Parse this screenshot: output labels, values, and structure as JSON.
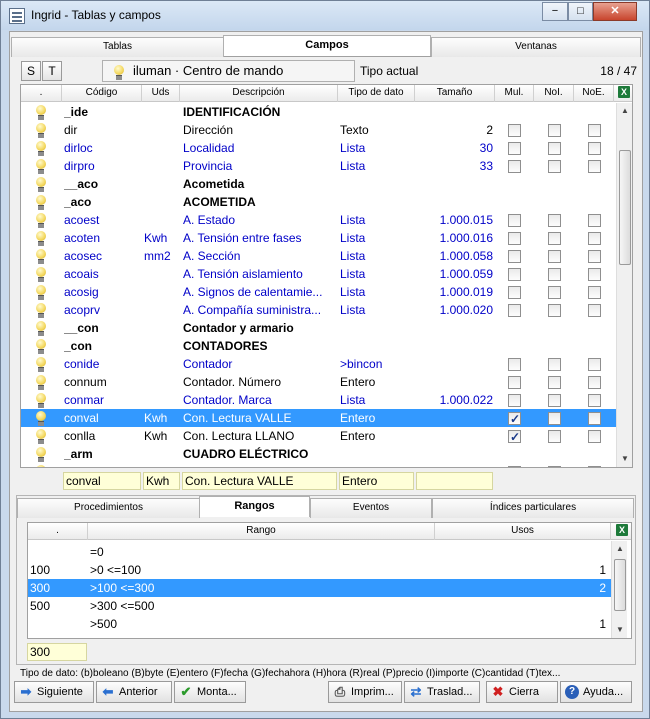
{
  "window": {
    "title": "Ingrid - Tablas y campos",
    "minimize": "−",
    "maximize": "□",
    "close": "✕"
  },
  "tabs_top": [
    "Tablas",
    "Campos",
    "Ventanas"
  ],
  "toolbar": {
    "s": "S",
    "t": "T",
    "context": "iluman · Centro de mando",
    "tipo_actual": "Tipo actual",
    "count": "18 / 47"
  },
  "grid": {
    "headers": {
      "dot": ".",
      "codigo": "Código",
      "uds": "Uds",
      "descripcion": "Descripción",
      "tipo": "Tipo de dato",
      "tamano": "Tamaño",
      "mul": "Mul.",
      "noi": "NoI.",
      "noe": "NoE."
    },
    "rows": [
      {
        "codigo": "_ide",
        "uds": "",
        "desc": "IDENTIFICACIÓN",
        "tipo": "",
        "tam": "",
        "style": "bold",
        "checks": false
      },
      {
        "codigo": "dir",
        "uds": "",
        "desc": "Dirección",
        "tipo": "Texto",
        "tam": "2",
        "style": "normal",
        "checks": true
      },
      {
        "codigo": "dirloc",
        "uds": "",
        "desc": "Localidad",
        "tipo": "Lista",
        "tam": "30",
        "style": "blue",
        "checks": true
      },
      {
        "codigo": "dirpro",
        "uds": "",
        "desc": "Provincia",
        "tipo": "Lista",
        "tam": "33",
        "style": "blue",
        "checks": true
      },
      {
        "codigo": "__aco",
        "uds": "",
        "desc": "Acometida",
        "tipo": "",
        "tam": "",
        "style": "bold",
        "checks": false
      },
      {
        "codigo": "_aco",
        "uds": "",
        "desc": "ACOMETIDA",
        "tipo": "",
        "tam": "",
        "style": "bold",
        "checks": false
      },
      {
        "codigo": "acoest",
        "uds": "",
        "desc": "A. Estado",
        "tipo": "Lista",
        "tam": "1.000.015",
        "style": "blue",
        "checks": true
      },
      {
        "codigo": "acoten",
        "uds": "Kwh",
        "desc": "A. Tensión entre fases",
        "tipo": "Lista",
        "tam": "1.000.016",
        "style": "blue",
        "checks": true
      },
      {
        "codigo": "acosec",
        "uds": "mm2",
        "desc": "A. Sección",
        "tipo": "Lista",
        "tam": "1.000.058",
        "style": "blue",
        "checks": true
      },
      {
        "codigo": "acoais",
        "uds": "",
        "desc": "A. Tensión aislamiento",
        "tipo": "Lista",
        "tam": "1.000.059",
        "style": "blue",
        "checks": true
      },
      {
        "codigo": "acosig",
        "uds": "",
        "desc": "A. Signos de calentamie...",
        "tipo": "Lista",
        "tam": "1.000.019",
        "style": "blue",
        "checks": true
      },
      {
        "codigo": "acoprv",
        "uds": "",
        "desc": "A. Compañía suministra...",
        "tipo": "Lista",
        "tam": "1.000.020",
        "style": "blue",
        "checks": true
      },
      {
        "codigo": "__con",
        "uds": "",
        "desc": "Contador y armario",
        "tipo": "",
        "tam": "",
        "style": "bold",
        "checks": false
      },
      {
        "codigo": "_con",
        "uds": "",
        "desc": "CONTADORES",
        "tipo": "",
        "tam": "",
        "style": "bold",
        "checks": false
      },
      {
        "codigo": "conide",
        "uds": "",
        "desc": "Contador",
        "tipo": ">bincon",
        "tam": "",
        "style": "blue",
        "checks": true
      },
      {
        "codigo": "connum",
        "uds": "",
        "desc": "Contador. Número",
        "tipo": "Entero",
        "tam": "",
        "style": "normal",
        "checks": true
      },
      {
        "codigo": "conmar",
        "uds": "",
        "desc": "Contador. Marca",
        "tipo": "Lista",
        "tam": "1.000.022",
        "style": "blue",
        "checks": true
      },
      {
        "codigo": "conval",
        "uds": "Kwh",
        "desc": "Con. Lectura VALLE",
        "tipo": "Entero",
        "tam": "",
        "style": "normal",
        "checks": true,
        "mul": true,
        "selected": true
      },
      {
        "codigo": "conlla",
        "uds": "Kwh",
        "desc": "Con. Lectura LLANO",
        "tipo": "Entero",
        "tam": "",
        "style": "normal",
        "checks": true,
        "mul": true
      },
      {
        "codigo": "_arm",
        "uds": "",
        "desc": "CUADRO ELÉCTRICO",
        "tipo": "",
        "tam": "",
        "style": "bold",
        "checks": false
      },
      {
        "codigo": "",
        "uds": "",
        "desc": "",
        "tipo": "",
        "tam": "",
        "style": "normal",
        "checks": true
      }
    ]
  },
  "editors": {
    "codigo": "conval",
    "uds": "Kwh",
    "desc": "Con. Lectura VALLE",
    "tipo": "Entero",
    "tam": ""
  },
  "tabs_bottom": [
    "Procedimientos",
    "Rangos",
    "Eventos",
    "Índices particulares"
  ],
  "ranges": {
    "headers": {
      "dot": ".",
      "rango": "Rango",
      "usos": "Usos"
    },
    "rows": [
      {
        "val": "",
        "rango": "=0",
        "usos": ""
      },
      {
        "val": "100",
        "rango": ">0 <=100",
        "usos": "1"
      },
      {
        "val": "300",
        "rango": ">100 <=300",
        "usos": "2",
        "selected": true
      },
      {
        "val": "500",
        "rango": ">300 <=500",
        "usos": ""
      },
      {
        "val": "",
        "rango": ">500",
        "usos": "1"
      }
    ],
    "editor": "300"
  },
  "legend": "Tipo de dato: (b)boleano (B)byte (E)entero (F)fecha (G)fechahora (H)hora (R)real (P)precio (I)importe (C)cantidad (T)tex...",
  "buttons": {
    "siguiente": "Siguiente",
    "anterior": "Anterior",
    "montar": "Monta...",
    "imprimir": "Imprim...",
    "trasladar": "Traslad...",
    "cierra": "Cierra",
    "ayuda": "Ayuda..."
  },
  "colors": {
    "selection": "#3399ff",
    "link_blue": "#0000c8",
    "editor_bg": "#ffffd8",
    "window_frame": "#c9d9ec"
  }
}
